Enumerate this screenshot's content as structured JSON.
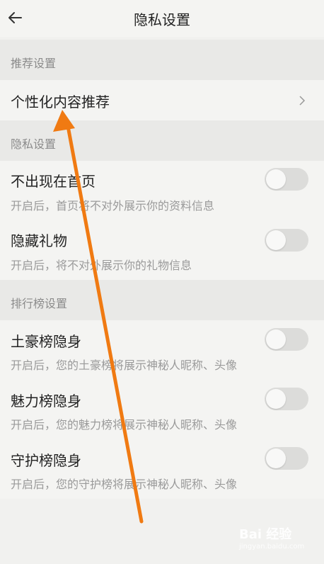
{
  "header": {
    "title": "隐私设置",
    "back_icon": "back-arrow-icon"
  },
  "sections": {
    "recommend": {
      "label": "推荐设置",
      "item": {
        "title": "个性化内容推荐",
        "icon": "chevron-right-icon"
      }
    },
    "privacy": {
      "label": "隐私设置",
      "items": [
        {
          "title": "不出现在首页",
          "subtitle": "开启后，首页将不对外展示你的资料信息",
          "enabled": false
        },
        {
          "title": "隐藏礼物",
          "subtitle": "开启后，将不对外展示你的礼物信息",
          "enabled": false
        }
      ]
    },
    "ranking": {
      "label": "排行榜设置",
      "items": [
        {
          "title": "土豪榜隐身",
          "subtitle": "开启后，您的土豪榜将展示神秘人昵称、头像",
          "enabled": false
        },
        {
          "title": "魅力榜隐身",
          "subtitle": "开启后，您的魅力榜将展示神秘人昵称、头像",
          "enabled": false
        },
        {
          "title": "守护榜隐身",
          "subtitle": "开启后，您的守护榜将展示神秘人昵称、头像",
          "enabled": false
        }
      ]
    }
  },
  "annotation": {
    "color": "#f07a12"
  },
  "watermark": {
    "text": "Bai 经验",
    "sub": "jingyan.baidu.com"
  }
}
